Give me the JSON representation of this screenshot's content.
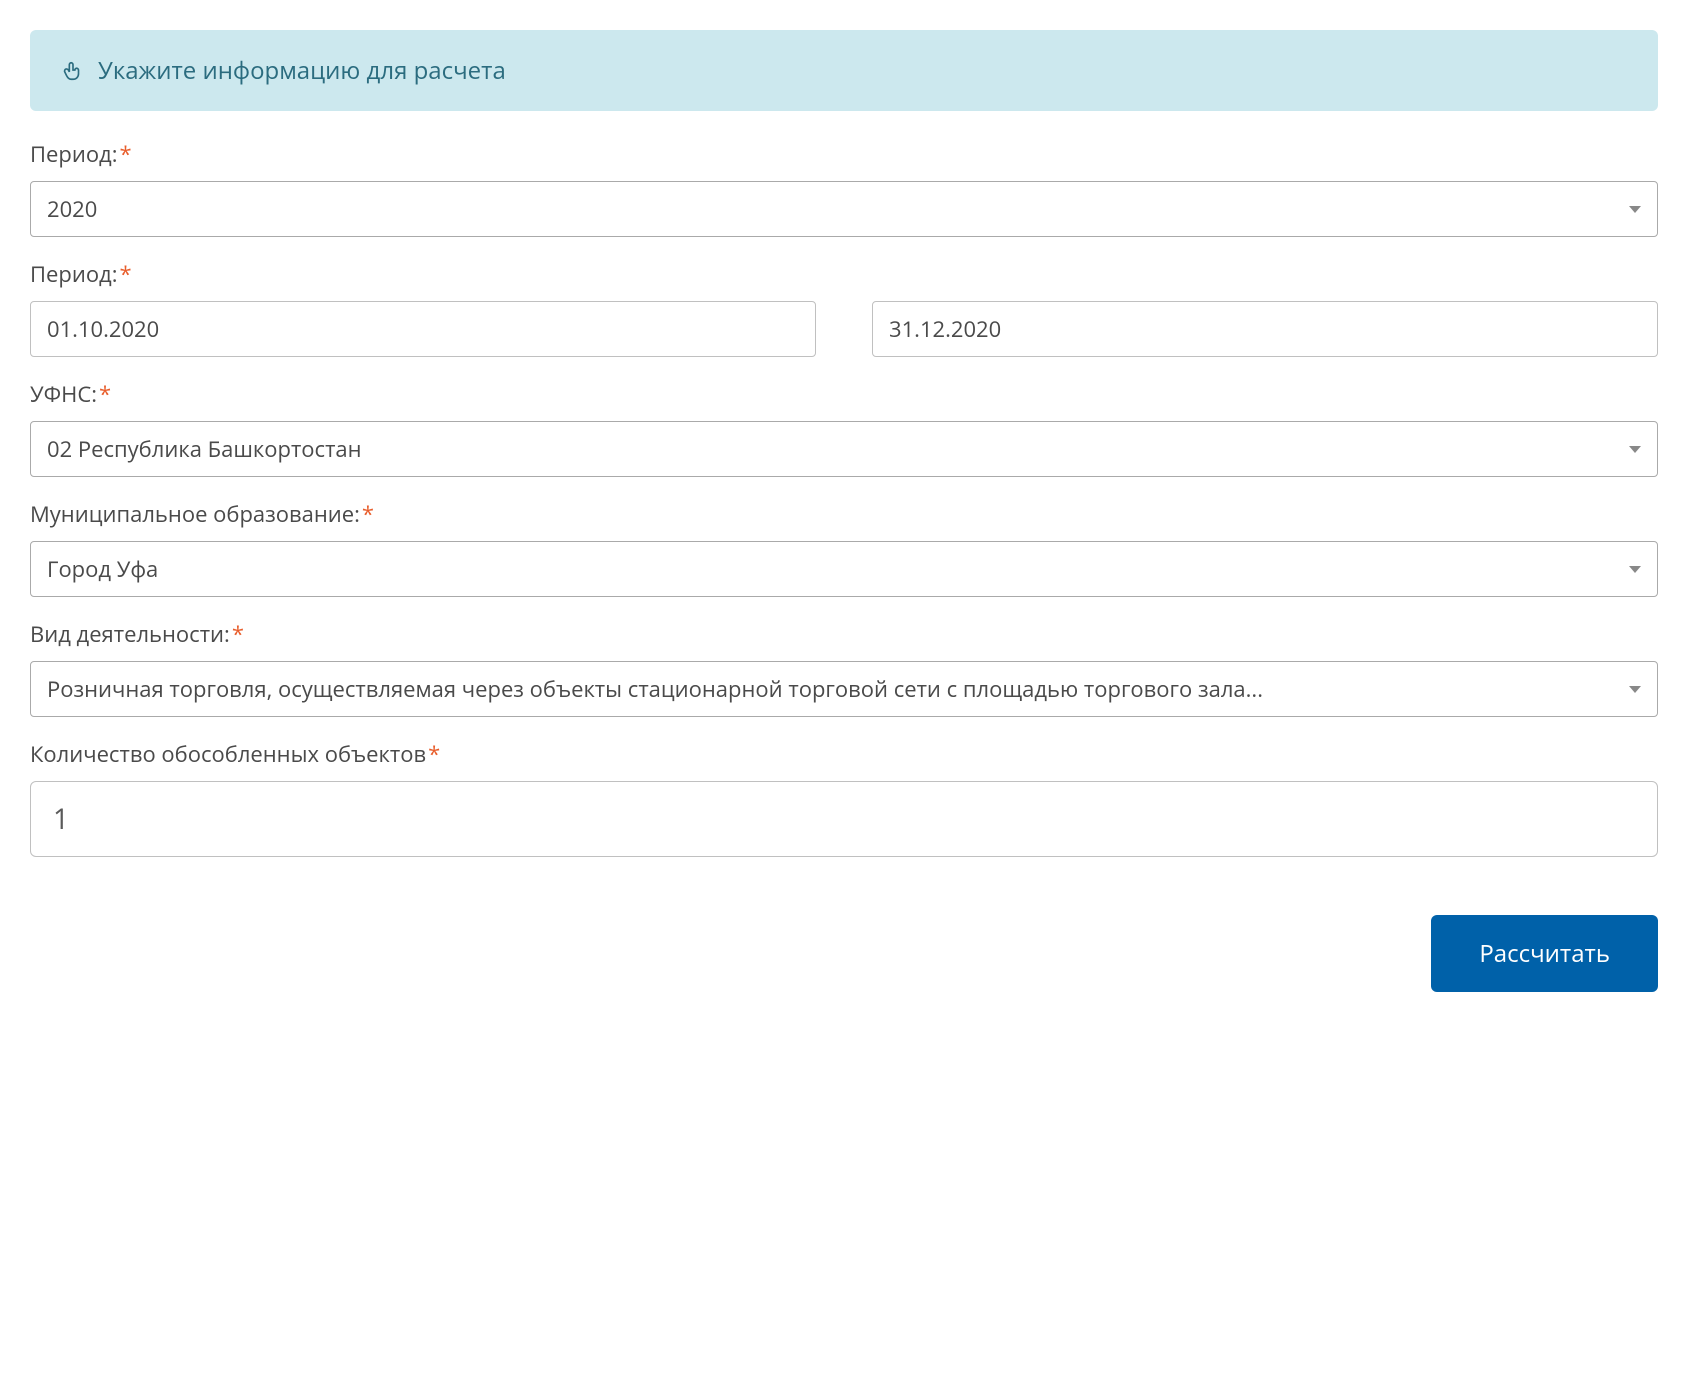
{
  "banner": {
    "text": "Укажите информацию для расчета"
  },
  "form": {
    "period_year": {
      "label": "Период:",
      "value": "2020"
    },
    "period_dates": {
      "label": "Период:",
      "from": "01.10.2020",
      "to": "31.12.2020"
    },
    "ufns": {
      "label": "УФНС:",
      "value": "02 Республика Башкортостан"
    },
    "municipality": {
      "label": "Муниципальное образование:",
      "value": "Город Уфа"
    },
    "activity": {
      "label": "Вид деятельности:",
      "value": "Розничная торговля, осуществляемая через объекты стационарной торговой сети с площадью торгового зала..."
    },
    "objects_count": {
      "label": "Количество обособленных объектов",
      "value": "1"
    }
  },
  "buttons": {
    "calculate": "Рассчитать"
  }
}
